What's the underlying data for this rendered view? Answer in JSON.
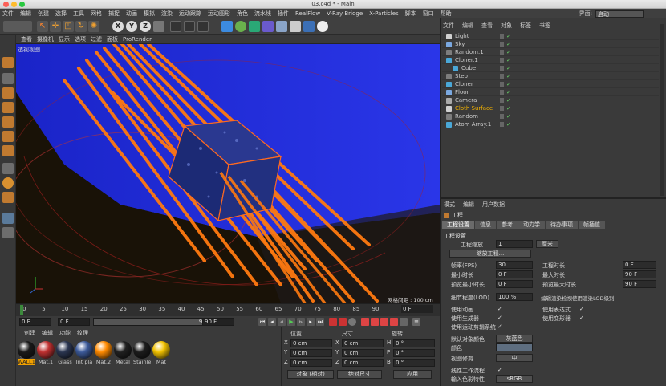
{
  "window": {
    "title": "03.c4d * - Main"
  },
  "menubar": {
    "items": [
      "文件",
      "编辑",
      "创建",
      "选择",
      "工具",
      "网格",
      "捕捉",
      "动画",
      "模拟",
      "渲染",
      "运动跟踪",
      "运动图形",
      "角色",
      "流水线",
      "插件",
      "RealFlow",
      "V-Ray Bridge",
      "X-Particles",
      "脚本",
      "窗口",
      "帮助"
    ]
  },
  "interface": {
    "label": "界面:",
    "value": "启动"
  },
  "viewport": {
    "menu": [
      "查看",
      "摄像机",
      "显示",
      "选项",
      "过滤",
      "面板",
      "ProRender"
    ],
    "label": "透视视图",
    "grid_label": "网格间距 : 100 cm"
  },
  "timeline": {
    "ticks": [
      "0",
      "5",
      "10",
      "15",
      "20",
      "25",
      "30",
      "35",
      "40",
      "45",
      "50",
      "55",
      "60",
      "65",
      "70",
      "75",
      "80",
      "85",
      "90"
    ],
    "current_frame": "0 F",
    "start": "0 F",
    "start2": "0 F",
    "end": "90 F",
    "end2": "90 F"
  },
  "materials": {
    "menu": [
      "创建",
      "编辑",
      "功能",
      "纹理"
    ],
    "items": [
      {
        "name": "WALL1",
        "color": "#1a1a1a"
      },
      {
        "name": "Mat.1",
        "color": "#c03030"
      },
      {
        "name": "Glass",
        "color": "#2a3550"
      },
      {
        "name": "Int pla",
        "color": "#3c5a9a"
      },
      {
        "name": "Mat.2",
        "color": "#ff8a00"
      },
      {
        "name": "Metal",
        "color": "#202020"
      },
      {
        "name": "Stainle",
        "color": "#1c1c1c"
      },
      {
        "name": "Mat",
        "color": "#f2c200"
      }
    ]
  },
  "coords": {
    "headers": [
      "位置",
      "尺寸",
      "旋转"
    ],
    "rows": [
      {
        "axis": "X",
        "pos": "0 cm",
        "size": "0 cm",
        "rot_axis": "H",
        "rot": "0 °"
      },
      {
        "axis": "Y",
        "pos": "0 cm",
        "size": "0 cm",
        "rot_axis": "P",
        "rot": "0 °"
      },
      {
        "axis": "Z",
        "pos": "0 cm",
        "size": "0 cm",
        "rot_axis": "B",
        "rot": "0 °"
      }
    ],
    "mode1": "对象 (相对)",
    "mode2": "绝对尺寸",
    "apply": "应用"
  },
  "objects": {
    "menu": [
      "文件",
      "编辑",
      "查看",
      "对象",
      "标签",
      "书签"
    ],
    "items": [
      {
        "name": "Light",
        "indent": 0,
        "color": "#ccc",
        "ico": "#d0d0d0"
      },
      {
        "name": "Sky",
        "indent": 0,
        "color": "#ccc",
        "ico": "#7aa8e0"
      },
      {
        "name": "Random.1",
        "indent": 0,
        "color": "#ccc",
        "ico": "#7d7d7d"
      },
      {
        "name": "Cloner.1",
        "indent": 0,
        "color": "#ccc",
        "ico": "#4aa8d8"
      },
      {
        "name": "Cube",
        "indent": 1,
        "color": "#ccc",
        "ico": "#4aa8d8"
      },
      {
        "name": "Step",
        "indent": 0,
        "color": "#ccc",
        "ico": "#7d7d7d"
      },
      {
        "name": "Cloner",
        "indent": 0,
        "color": "#ccc",
        "ico": "#4aa8d8"
      },
      {
        "name": "Floor",
        "indent": 0,
        "color": "#ccc",
        "ico": "#7aa8e0"
      },
      {
        "name": "Camera",
        "indent": 0,
        "color": "#ccc",
        "ico": "#aaaaaa"
      },
      {
        "name": "Cloth Surface",
        "indent": 0,
        "color": "#f0b000",
        "ico": "#d0d0d0"
      },
      {
        "name": "Random",
        "indent": 0,
        "color": "#ccc",
        "ico": "#7d7d7d"
      },
      {
        "name": "Atom Array.1",
        "indent": 0,
        "color": "#ccc",
        "ico": "#4aa8d8"
      }
    ]
  },
  "attributes": {
    "menu": [
      "模式",
      "编辑",
      "用户数据"
    ],
    "header": "工程",
    "tabs": [
      "工程设置",
      "信息",
      "参考",
      "动力学",
      "待办事项",
      "帧插值"
    ],
    "section": "工程设置",
    "scale_label": "工程缩放",
    "scale_value": "1",
    "scale_unit": "厘米",
    "scale_button": "缩放工程...",
    "fps_label": "帧率(FPS)",
    "fps": "30",
    "min_label": "最小时长",
    "min": "0 F",
    "preview_min_label": "预览最小时长",
    "preview_min": "0 F",
    "lod_label": "细节程度(LOD)",
    "lod": "100 %",
    "project_time_label": "工程时长",
    "project_time": "0 F",
    "max_label": "最大时长",
    "max": "90 F",
    "preview_max_label": "预览最大时长",
    "preview_max": "90 F",
    "render_lod_label": "编辑渲染检视使用渲染LOD级别",
    "use_anim": "使用动画",
    "use_gen": "使用生成器",
    "use_motion": "使用运动剪辑系统",
    "use_expr": "使用表达式",
    "use_deform": "使用变形器",
    "default_color_label": "默认对象颜色",
    "default_color_value": "灰蓝色",
    "color_label": "颜色",
    "view_clip_label": "视图修剪",
    "view_clip_value": "中",
    "linear_label": "线性工作流程",
    "input_color_label": "输入色彩特性",
    "input_color_value": "sRGB"
  }
}
